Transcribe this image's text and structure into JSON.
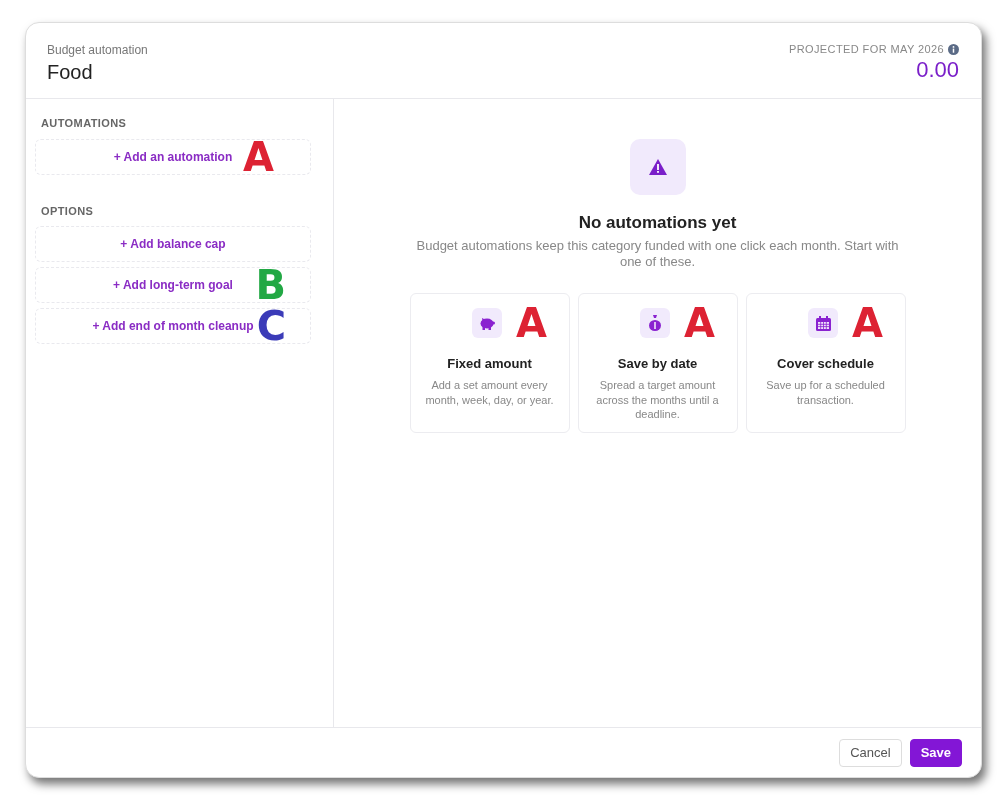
{
  "header": {
    "subtitle": "Budget automation",
    "title": "Food",
    "projection_label": "PROJECTED FOR MAY 2026",
    "projection_value": "0.00"
  },
  "sidebar": {
    "sections": [
      {
        "heading": "AUTOMATIONS",
        "items": [
          {
            "label": "+ Add an automation",
            "marker": {
              "label": "A",
              "color": "#dd2233"
            }
          }
        ]
      },
      {
        "heading": "OPTIONS",
        "items": [
          {
            "label": "+ Add balance cap"
          },
          {
            "label": "+ Add long-term goal",
            "marker": {
              "label": "B",
              "color": "#22a844"
            }
          },
          {
            "label": "+ Add end of month cleanup",
            "marker": {
              "label": "C",
              "color": "#3b3bb8"
            }
          }
        ]
      }
    ]
  },
  "empty_state": {
    "title": "No automations yet",
    "description": "Budget automations keep this category funded with one click each month. Start with one of these."
  },
  "templates": [
    {
      "kind": "piggy",
      "title": "Fixed amount",
      "description": "Add a set amount every month, week, day, or year.",
      "marker": {
        "label": "A",
        "color": "#dd2233"
      }
    },
    {
      "kind": "moneybag",
      "title": "Save by date",
      "description": "Spread a target amount across the months until a deadline.",
      "marker": {
        "label": "A",
        "color": "#dd2233"
      }
    },
    {
      "kind": "calendar",
      "title": "Cover schedule",
      "description": "Save up for a scheduled transaction.",
      "marker": {
        "label": "A",
        "color": "#dd2233"
      }
    }
  ],
  "footer": {
    "buttons": [
      {
        "label": "Cancel",
        "kind": "secondary"
      },
      {
        "label": "Save",
        "kind": "primary"
      }
    ]
  }
}
